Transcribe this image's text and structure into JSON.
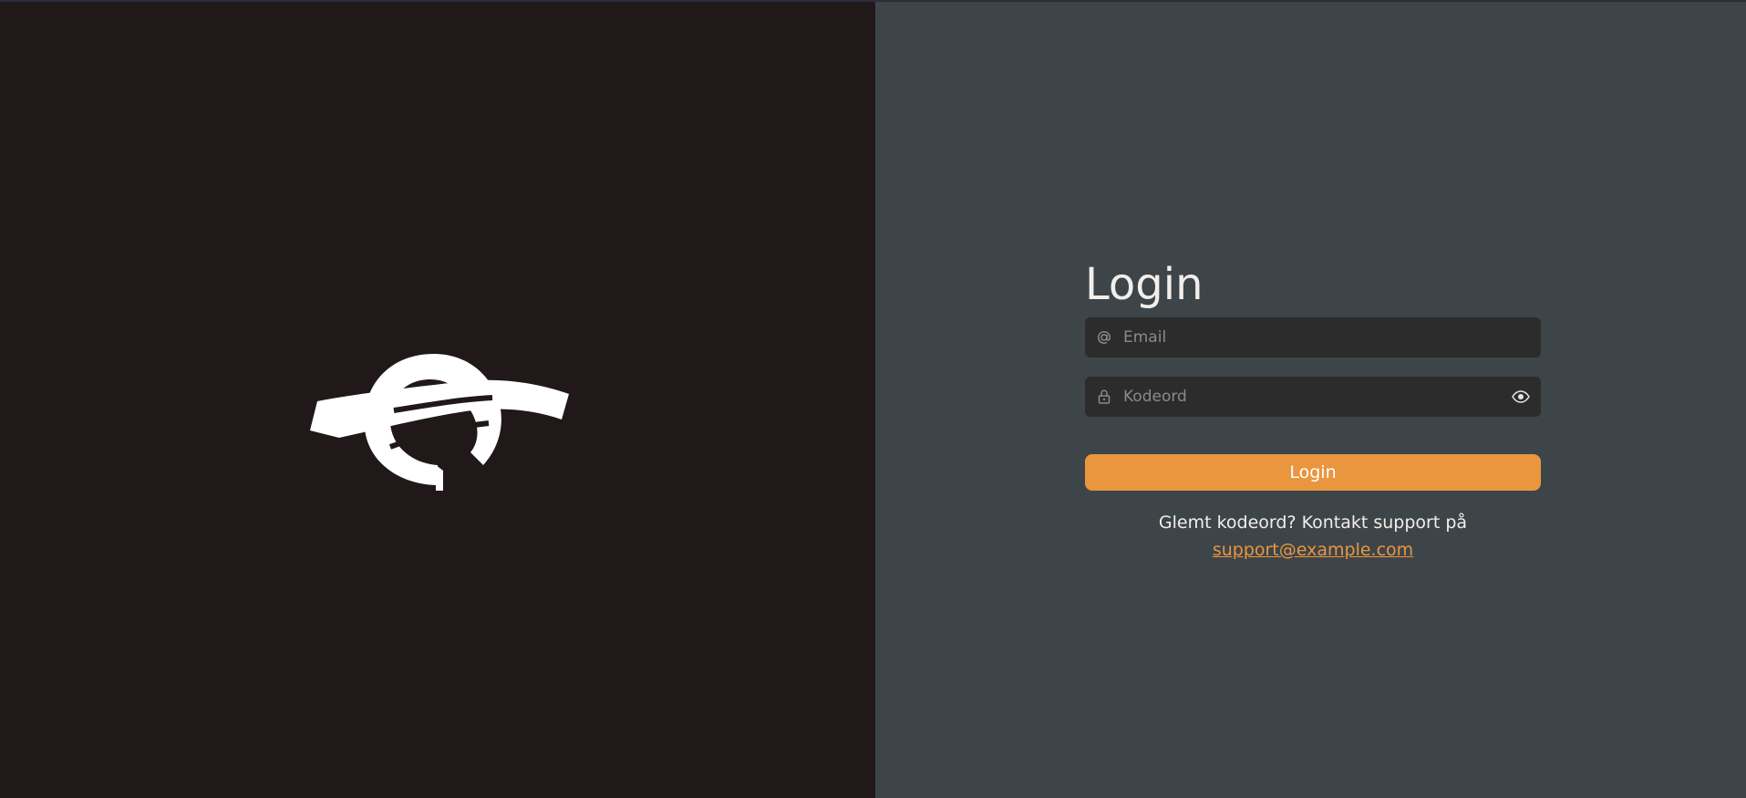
{
  "colors": {
    "left_bg": "#211819",
    "right_bg": "#3d4549",
    "field_bg": "#2c2c2c",
    "accent": "#ea963e",
    "text": "#f2eeea",
    "placeholder": "#8a8a8a"
  },
  "brand": {
    "logo_icon": "stylized-e-icon"
  },
  "login": {
    "title": "Login",
    "email": {
      "icon": "at-icon",
      "placeholder": "Email",
      "value": ""
    },
    "password": {
      "icon": "lock-icon",
      "placeholder": "Kodeord",
      "value": "",
      "toggle_icon": "eye-icon"
    },
    "submit_label": "Login",
    "forgot_text": "Glemt kodeord? Kontakt support på",
    "support_email": "support@example.com"
  }
}
